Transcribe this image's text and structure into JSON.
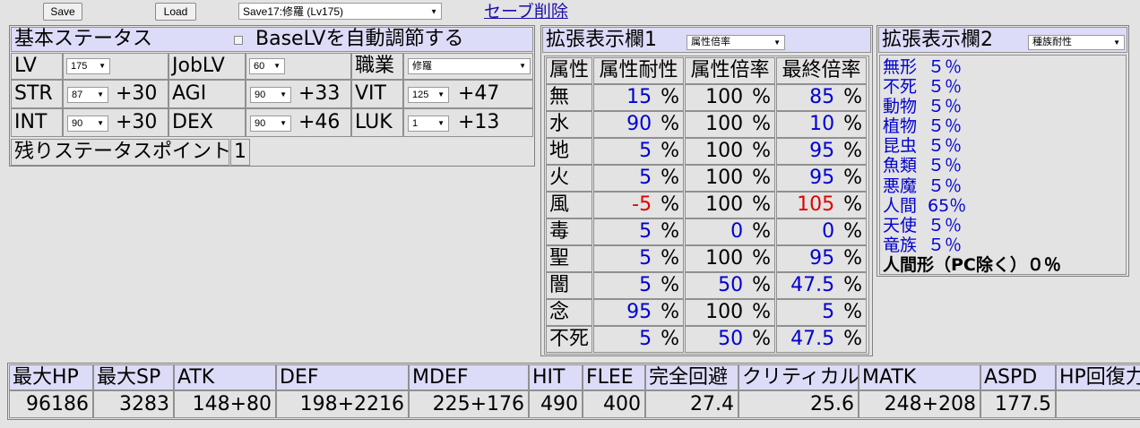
{
  "toolbar": {
    "save_label": "Save",
    "load_label": "Load",
    "save_slot": "Save17:修羅 (Lv175)",
    "delete_label": "セーブ削除"
  },
  "basic": {
    "title": "基本ステータス",
    "auto_label": "BaseLVを自動調節する",
    "lv_label": "LV",
    "lv_value": "175",
    "joblv_label": "JobLV",
    "joblv_value": "60",
    "job_label": "職業",
    "job_value": "修羅",
    "stats": [
      {
        "label": "STR",
        "value": "87",
        "bonus": "+30"
      },
      {
        "label": "AGI",
        "value": "90",
        "bonus": "+33"
      },
      {
        "label": "VIT",
        "value": "125",
        "bonus": "+47"
      },
      {
        "label": "INT",
        "value": "90",
        "bonus": "+30"
      },
      {
        "label": "DEX",
        "value": "90",
        "bonus": "+46"
      },
      {
        "label": "LUK",
        "value": "1",
        "bonus": "+13"
      }
    ],
    "remain_label": "残りステータスポイント",
    "remain_value": "1"
  },
  "ext1": {
    "title": "拡張表示欄1",
    "select": "属性倍率",
    "headers": [
      "属性",
      "属性耐性",
      "属性倍率",
      "最終倍率"
    ],
    "rows": [
      {
        "elem": "無",
        "res": "15",
        "mult": "100",
        "final": "85"
      },
      {
        "elem": "水",
        "res": "90",
        "mult": "100",
        "final": "10"
      },
      {
        "elem": "地",
        "res": "5",
        "mult": "100",
        "final": "95"
      },
      {
        "elem": "火",
        "res": "5",
        "mult": "100",
        "final": "95"
      },
      {
        "elem": "風",
        "res": "-5",
        "mult": "100",
        "final": "105"
      },
      {
        "elem": "毒",
        "res": "5",
        "mult": "0",
        "final": "0"
      },
      {
        "elem": "聖",
        "res": "5",
        "mult": "100",
        "final": "95"
      },
      {
        "elem": "闇",
        "res": "5",
        "mult": "50",
        "final": "47.5"
      },
      {
        "elem": "念",
        "res": "95",
        "mult": "100",
        "final": "5"
      },
      {
        "elem": "不死",
        "res": "5",
        "mult": "50",
        "final": "47.5"
      }
    ],
    "pct": "%"
  },
  "ext2": {
    "title": "拡張表示欄2",
    "select": "種族耐性",
    "races": [
      {
        "name": "無形",
        "value": "５％"
      },
      {
        "name": "不死",
        "value": "５％"
      },
      {
        "name": "動物",
        "value": "５％"
      },
      {
        "name": "植物",
        "value": "５％"
      },
      {
        "name": "昆虫",
        "value": "５％"
      },
      {
        "name": "魚類",
        "value": "５％"
      },
      {
        "name": "悪魔",
        "value": "５％"
      },
      {
        "name": "人間",
        "value": "65％"
      },
      {
        "name": "天使",
        "value": "５％"
      },
      {
        "name": "竜族",
        "value": "５％"
      }
    ],
    "humanoid": "人間形（PC除く）０％"
  },
  "summary": {
    "cols": [
      {
        "label": "最大HP",
        "value": "96186"
      },
      {
        "label": "最大SP",
        "value": "3283"
      },
      {
        "label": "ATK",
        "value": "148+80"
      },
      {
        "label": "DEF",
        "value": "198+2216"
      },
      {
        "label": "MDEF",
        "value": "225+176"
      },
      {
        "label": "HIT",
        "value": "490"
      },
      {
        "label": "FLEE",
        "value": "400"
      },
      {
        "label": "完全回避",
        "value": "27.4"
      },
      {
        "label": "クリティカル",
        "value": "25.6"
      },
      {
        "label": "MATK",
        "value": "248+208"
      },
      {
        "label": "ASPD",
        "value": "177.5"
      },
      {
        "label": "HP回復力",
        "value": ""
      }
    ]
  }
}
